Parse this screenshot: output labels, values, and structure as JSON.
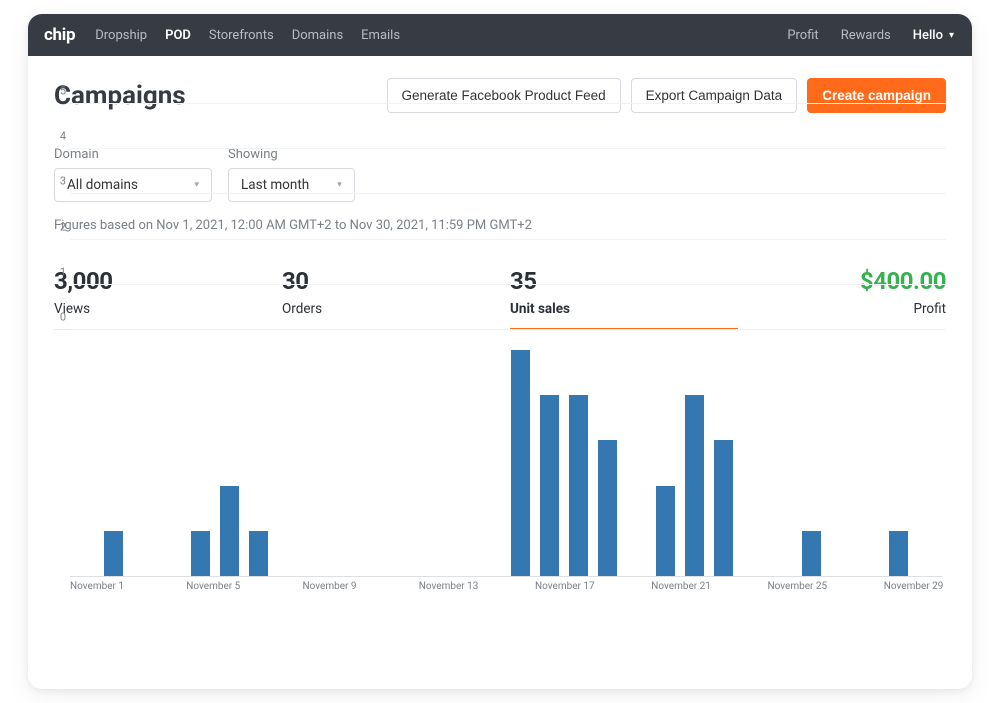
{
  "logo": "chip",
  "nav": {
    "items": [
      {
        "label": "Dropship"
      },
      {
        "label": "POD",
        "active": true
      },
      {
        "label": "Storefronts"
      },
      {
        "label": "Domains"
      },
      {
        "label": "Emails"
      }
    ],
    "right": {
      "profit": "Profit",
      "rewards": "Rewards",
      "hello": "Hello"
    }
  },
  "page_title": "Campaigns",
  "buttons": {
    "facebook_feed": "Generate Facebook Product Feed",
    "export": "Export Campaign Data",
    "create": "Create campaign"
  },
  "filters": {
    "domain_label": "Domain",
    "domain_value": "All domains",
    "showing_label": "Showing",
    "showing_value": "Last month"
  },
  "figures_note": "Figures based on Nov 1, 2021, 12:00 AM GMT+2 to Nov 30, 2021, 11:59 PM GMT+2",
  "stats": {
    "views": {
      "value": "3,000",
      "label": "Views"
    },
    "orders": {
      "value": "30",
      "label": "Orders"
    },
    "unit_sales": {
      "value": "35",
      "label": "Unit sales"
    },
    "profit": {
      "value": "$400.00",
      "label": "Profit"
    }
  },
  "chart_data": {
    "type": "bar",
    "title": "",
    "xlabel": "",
    "ylabel": "",
    "ylim": [
      0,
      5
    ],
    "yticks": [
      0,
      1,
      2,
      3,
      4,
      5
    ],
    "categories": [
      "November 1",
      "November 2",
      "November 3",
      "November 4",
      "November 5",
      "November 6",
      "November 7",
      "November 8",
      "November 9",
      "November 10",
      "November 11",
      "November 12",
      "November 13",
      "November 14",
      "November 15",
      "November 16",
      "November 17",
      "November 18",
      "November 19",
      "November 20",
      "November 21",
      "November 22",
      "November 23",
      "November 24",
      "November 25",
      "November 26",
      "November 27",
      "November 28",
      "November 29",
      "November 30"
    ],
    "values": [
      0,
      1,
      0,
      0,
      1,
      2,
      1,
      0,
      0,
      0,
      0,
      0,
      0,
      0,
      0,
      5,
      4,
      4,
      3,
      0,
      2,
      4,
      3,
      0,
      0,
      1,
      0,
      0,
      1,
      0
    ],
    "x_tick_labels": [
      "November 1",
      "November 5",
      "November 9",
      "November 13",
      "November 17",
      "November 21",
      "November 25",
      "November 29"
    ]
  }
}
